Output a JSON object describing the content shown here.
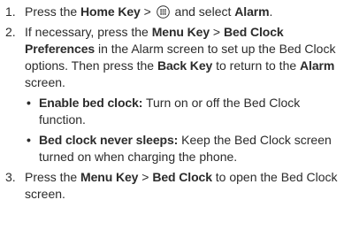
{
  "steps": [
    {
      "num": "1.",
      "t1": "Press the ",
      "b1": "Home Key",
      "t2": " > ",
      "icon": "apps-grid-icon",
      "t3": " and select ",
      "b2": "Alarm",
      "t4": "."
    },
    {
      "num": "2.",
      "t1": "If necessary, press the ",
      "b1": "Menu Key",
      "t2": " > ",
      "b2": "Bed Clock Preferences",
      "t3": " in the Alarm screen to set up the Bed Clock options. Then press the ",
      "b3": "Back Key",
      "t4": " to return to the ",
      "b4": "Alarm",
      "t5": " screen.",
      "bullets": [
        {
          "dot": "•",
          "term": "Enable bed clock:",
          "desc": " Turn on or off the Bed Clock function."
        },
        {
          "dot": "•",
          "term": "Bed clock never sleeps:",
          "desc": " Keep the Bed Clock screen turned on when charging the phone."
        }
      ]
    },
    {
      "num": "3.",
      "t1": "Press the ",
      "b1": "Menu Key",
      "t2": " > ",
      "b2": "Bed Clock",
      "t3": " to open the Bed Clock screen."
    }
  ]
}
